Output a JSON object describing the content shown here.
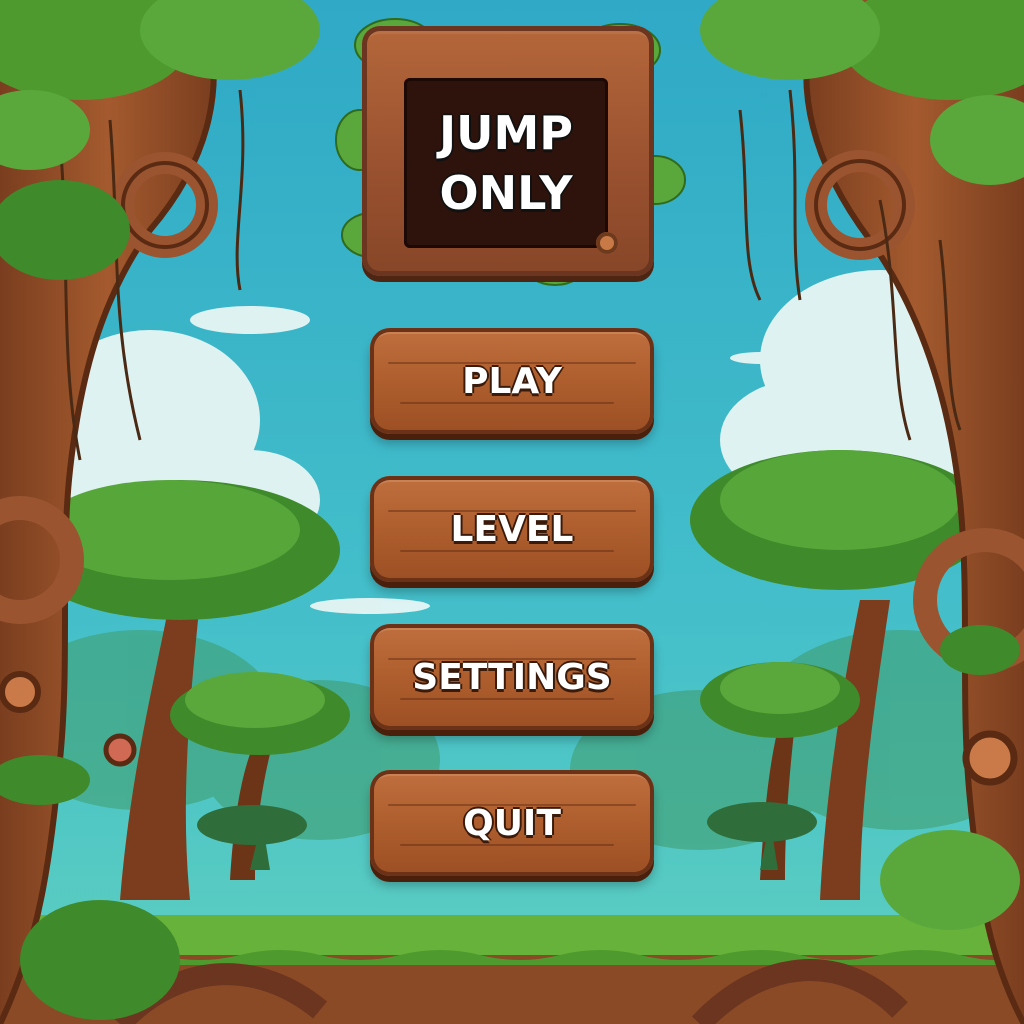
{
  "title": {
    "line1": "JUMP",
    "line2": "ONLY"
  },
  "menu": {
    "play_label": "PLAY",
    "level_label": "LEVEL",
    "settings_label": "SETTINGS",
    "quit_label": "QUIT"
  },
  "colors": {
    "sky": "#3fb6c9",
    "wood": "#b0602f",
    "wood_dark": "#6b3218",
    "leaf": "#4e9a2f",
    "grass": "#6fb83a",
    "title_board": "#2e130c",
    "text": "#ffffff"
  }
}
